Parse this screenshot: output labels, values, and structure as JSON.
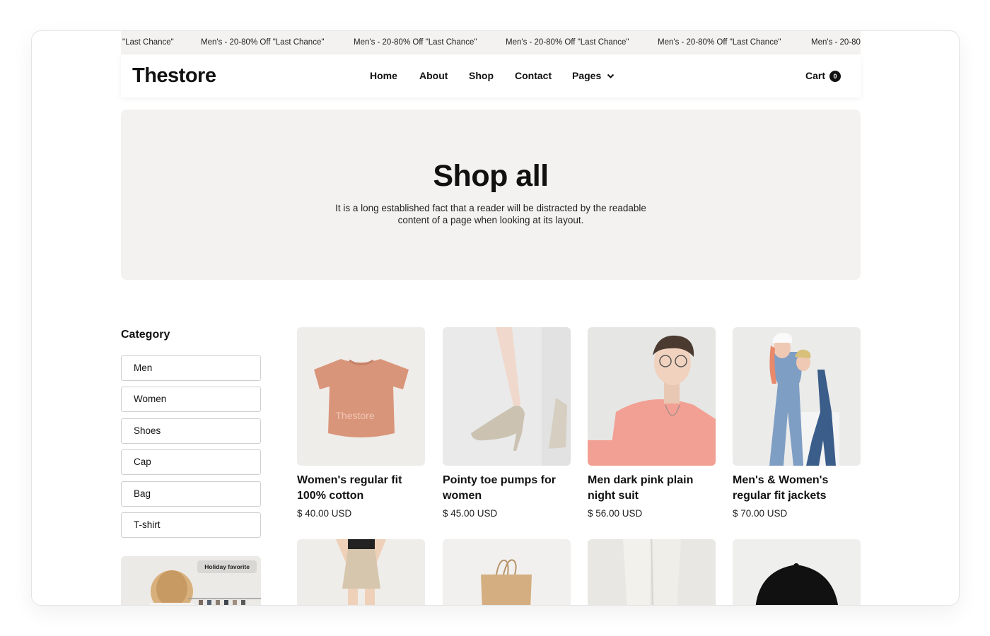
{
  "ticker": {
    "items": [
      "\"Last Chance\"",
      "Men's - 20-80% Off \"Last Chance\"",
      "Men's - 20-80% Off \"Last Chance\"",
      "Men's - 20-80% Off \"Last Chance\"",
      "Men's - 20-80% Off \"Last Chance\"",
      "Men's - 20-80"
    ]
  },
  "header": {
    "logo": "Thestore",
    "nav": [
      "Home",
      "About",
      "Shop",
      "Contact",
      "Pages"
    ],
    "cart_label": "Cart",
    "cart_count": "0"
  },
  "hero": {
    "title": "Shop all",
    "description": "It is a long established fact that a reader will be distracted by the readable content of a page when looking at its layout."
  },
  "sidebar": {
    "title": "Category",
    "categories": [
      "Men",
      "Women",
      "Shoes",
      "Cap",
      "Bag",
      "T-shirt"
    ],
    "promo_badge": "Holiday favorite"
  },
  "products": [
    {
      "name": "Women's regular fit 100% cotton",
      "price": "$ 40.00 USD",
      "image_text": "Thestore"
    },
    {
      "name": "Pointy toe pumps for women",
      "price": "$ 45.00 USD"
    },
    {
      "name": "Men dark pink plain night suit",
      "price": "$ 56.00 USD"
    },
    {
      "name": "Men's & Women's regular fit jackets",
      "price": "$ 70.00 USD"
    }
  ],
  "colors": {
    "panel_bg": "#f3f2f0",
    "text": "#111111",
    "tshirt": "#d9957a",
    "pink_shirt": "#f2a093"
  }
}
